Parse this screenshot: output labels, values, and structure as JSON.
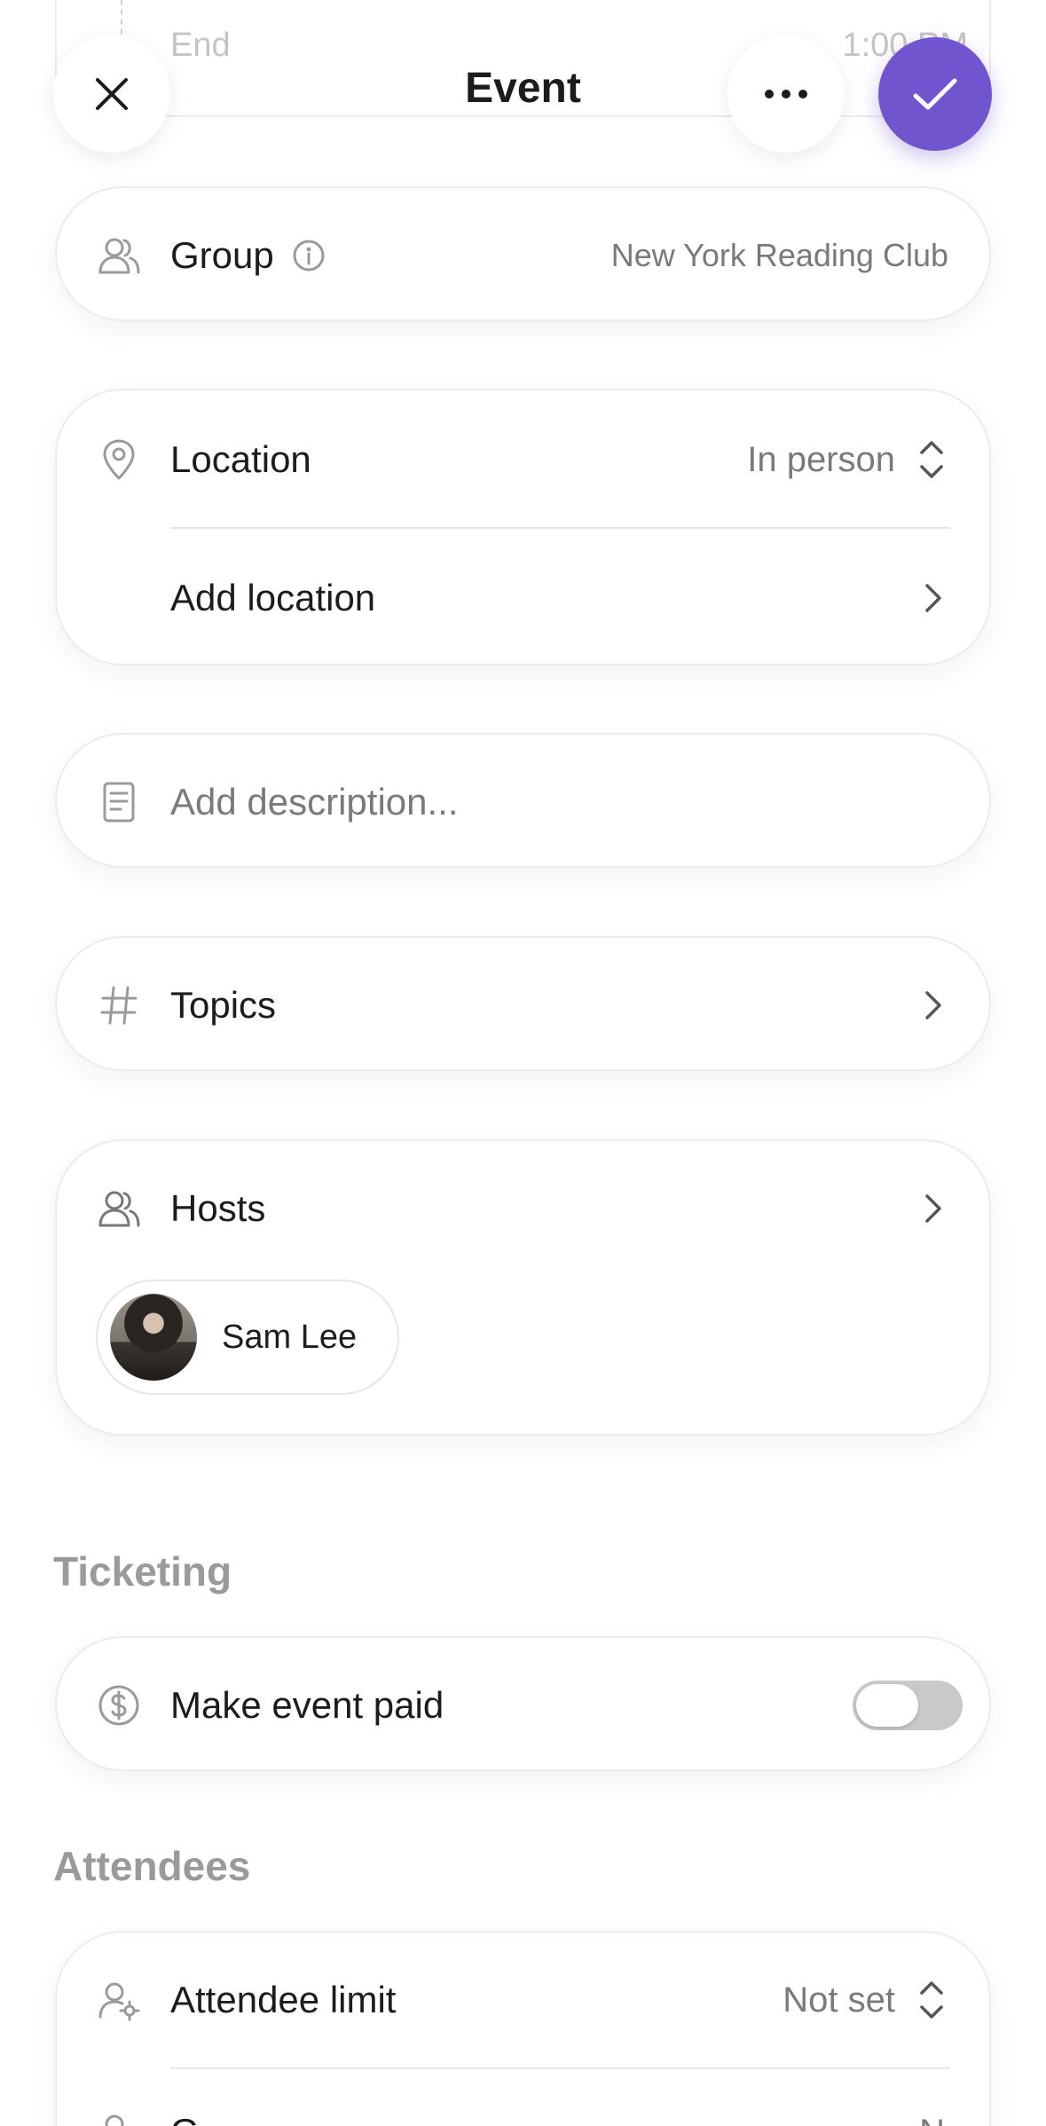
{
  "header": {
    "title": "Event",
    "behind_label": "End",
    "behind_value": "1:00 PM",
    "close_icon": "close-icon",
    "more_icon": "more-icon",
    "confirm_icon": "check-icon",
    "accent": "#7055cf"
  },
  "group": {
    "label": "Group",
    "value": "New York Reading Club"
  },
  "location": {
    "label": "Location",
    "mode": "In person",
    "add_label": "Add location"
  },
  "description": {
    "placeholder": "Add description..."
  },
  "topics": {
    "label": "Topics"
  },
  "hosts": {
    "label": "Hosts",
    "items": [
      {
        "name": "Sam Lee"
      }
    ]
  },
  "ticketing": {
    "title": "Ticketing",
    "paid_label": "Make event paid",
    "paid_enabled": false
  },
  "attendees": {
    "title": "Attendees",
    "limit_label": "Attendee limit",
    "limit_value": "Not set",
    "next_label": "G",
    "next_value": "N"
  }
}
